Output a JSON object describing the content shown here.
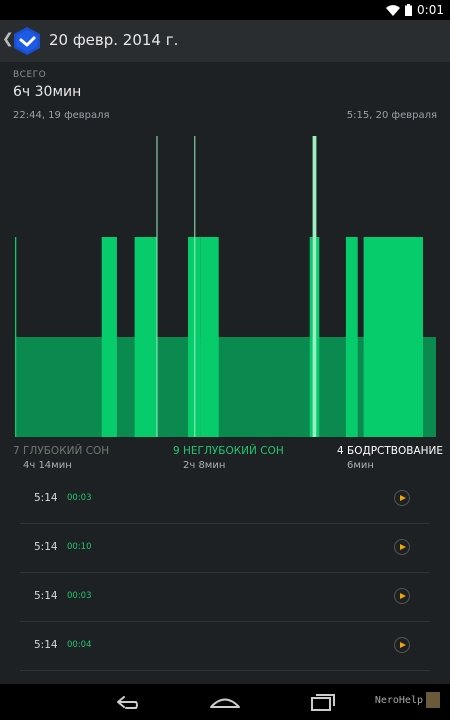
{
  "status_bar": {
    "time": "0:01"
  },
  "header": {
    "title": "20 февр. 2014 г."
  },
  "summary": {
    "total_label": "ВСЕГО",
    "total_value": "6ч 30мин",
    "start_time": "22:44, 19 февраля",
    "end_time": "5:15, 20 февраля"
  },
  "colors": {
    "deep": "#0a8a4e",
    "light": "#07cc6c",
    "awake": "#9af0c2",
    "event_duration": "#1fc86f",
    "play": "#f2a400",
    "legend_deep": "#6b7a72",
    "legend_light": "#1fc86f",
    "legend_awake": "#ffffff"
  },
  "chart_data": {
    "type": "bar",
    "x_start": "22:44",
    "x_end": "5:15",
    "levels": [
      "deep",
      "light",
      "awake"
    ],
    "segments": [
      {
        "level": "light",
        "start": 0.0,
        "end": 0.003
      },
      {
        "level": "light",
        "start": 0.206,
        "end": 0.242
      },
      {
        "level": "light",
        "start": 0.284,
        "end": 0.336
      },
      {
        "level": "awake",
        "start": 0.336,
        "end": 0.338
      },
      {
        "level": "light",
        "start": 0.411,
        "end": 0.44
      },
      {
        "level": "awake",
        "start": 0.426,
        "end": 0.428
      },
      {
        "level": "light",
        "start": 0.44,
        "end": 0.484
      },
      {
        "level": "light",
        "start": 0.7,
        "end": 0.707
      },
      {
        "level": "awake",
        "start": 0.707,
        "end": 0.716
      },
      {
        "level": "light",
        "start": 0.716,
        "end": 0.723
      },
      {
        "level": "light",
        "start": 0.786,
        "end": 0.814
      },
      {
        "level": "light",
        "start": 0.828,
        "end": 0.969
      }
    ]
  },
  "legend": [
    {
      "count": "7",
      "label": "ГЛУБОКИЙ СОН",
      "time": "4ч 14мин"
    },
    {
      "count": "9",
      "label": "НЕГЛУБОКИЙ СОН",
      "time": "2ч 8мин"
    },
    {
      "count": "4",
      "label": "БОДРСТВОВАНИЕ",
      "time": "6мин"
    }
  ],
  "events": [
    {
      "time": "5:14",
      "duration": "00:03"
    },
    {
      "time": "5:14",
      "duration": "00:10"
    },
    {
      "time": "5:14",
      "duration": "00:03"
    },
    {
      "time": "5:14",
      "duration": "00:04"
    }
  ],
  "watermark": "NeroHelp"
}
